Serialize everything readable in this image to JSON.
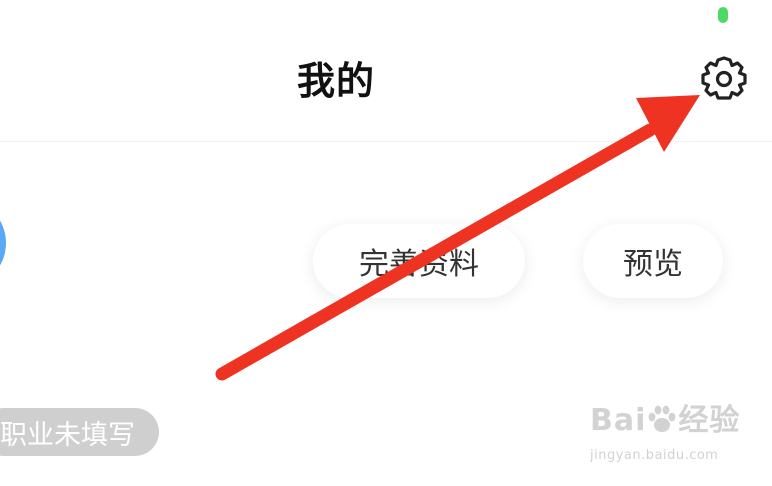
{
  "status_bar": {
    "indicator_color": "#4cd964"
  },
  "header": {
    "title": "我的",
    "settings_icon": "gear-icon"
  },
  "profile": {
    "avatar_color": "#5aa9f5",
    "edit_profile_label": "完善资料",
    "preview_label": "预览",
    "occupation_tag": "职业未填写",
    "occupation_tag_color": "#cfcfcf"
  },
  "annotation": {
    "arrow_color": "#ee3322"
  },
  "watermark": {
    "logo_left": "Bai",
    "logo_right": "经验",
    "url": "jingyan.baidu.com"
  }
}
